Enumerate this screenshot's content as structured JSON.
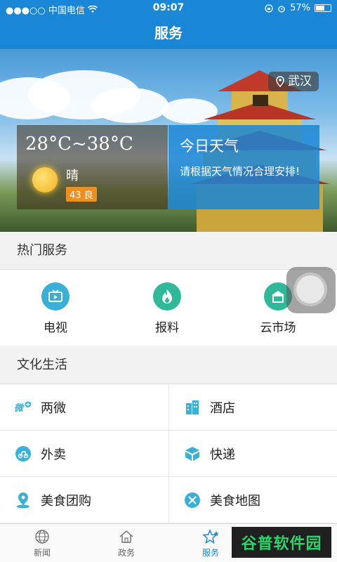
{
  "status_bar": {
    "carrier": "●●●○○ 中国电信",
    "time": "09:07",
    "battery": "57%"
  },
  "header": {
    "title": "服务"
  },
  "banner": {
    "location": "武汉",
    "temperature": "28°C~38°C",
    "condition": "晴",
    "aqi": "43 良",
    "today_title": "今日天气",
    "today_desc": "请根据天气情况合理安排!"
  },
  "hot_services": {
    "title": "热门服务",
    "items": [
      {
        "label": "电视",
        "icon": "tv-icon",
        "color": "#3ab0d6"
      },
      {
        "label": "报料",
        "icon": "flame-icon",
        "color": "#2fb89a"
      },
      {
        "label": "云市场",
        "icon": "market-icon",
        "color": "#2fb89a"
      }
    ]
  },
  "culture_life": {
    "title": "文化生活",
    "items": [
      {
        "label": "两微",
        "icon": "weibo-weixin-icon"
      },
      {
        "label": "酒店",
        "icon": "hotel-icon"
      },
      {
        "label": "外卖",
        "icon": "delivery-icon"
      },
      {
        "label": "快递",
        "icon": "parcel-icon"
      },
      {
        "label": "美食团购",
        "icon": "location-pin-icon"
      },
      {
        "label": "美食地图",
        "icon": "food-map-icon"
      }
    ]
  },
  "tabbar": {
    "items": [
      {
        "label": "新闻",
        "icon": "globe-icon"
      },
      {
        "label": "政务",
        "icon": "home-icon"
      },
      {
        "label": "服务",
        "icon": "star-icon",
        "active": true
      }
    ]
  },
  "watermark": "谷普软件园",
  "colors": {
    "primary": "#1a86d6",
    "accent": "#2fb89a",
    "aqi_badge": "#ef8f1f"
  }
}
